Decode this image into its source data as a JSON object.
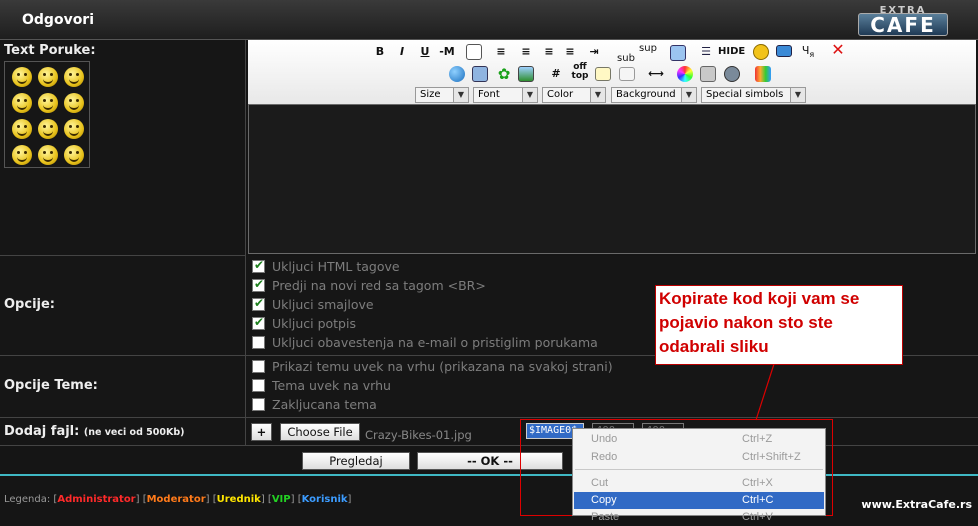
{
  "header": {
    "title": "Odgovori",
    "logo_top": "EXTRA",
    "logo_main": "CAFE"
  },
  "message": {
    "label": "Text Poruke:"
  },
  "toolbar": {
    "hide_label": "HIDE",
    "sub_label": "sub",
    "sup_label": "sup",
    "hash_label": "#",
    "offtop_label": "off top",
    "selects": [
      {
        "label": "Size"
      },
      {
        "label": "Font"
      },
      {
        "label": "Color"
      },
      {
        "label": "Background"
      },
      {
        "label": "Special simbols"
      }
    ]
  },
  "options": {
    "label": "Opcije:",
    "items": [
      {
        "text": "Ukljuci HTML tagove",
        "checked": true
      },
      {
        "text": "Predji na novi red sa tagom <BR>",
        "checked": true
      },
      {
        "text": "Ukljuci smajlove",
        "checked": true
      },
      {
        "text": "Ukljuci potpis",
        "checked": true
      },
      {
        "text": "Ukljuci obavestenja na e-mail o pristiglim porukama",
        "checked": false
      }
    ]
  },
  "topic_options": {
    "label": "Opcije Teme:",
    "items": [
      {
        "text": "Prikazi temu uvek na vrhu (prikazana na svakoj strani)",
        "checked": false
      },
      {
        "text": "Tema uvek na vrhu",
        "checked": false
      },
      {
        "text": "Zakljucana tema",
        "checked": false
      }
    ]
  },
  "file": {
    "label": "Dodaj fajl:",
    "note": "(ne veci od 500Kb)",
    "add_label": "+",
    "choose_label": "Choose File",
    "filename": "Crazy-Bikes-01.jpg",
    "image_code": "$IMAGE0$",
    "width_value": "400",
    "height_value": "400"
  },
  "actions": {
    "preview_label": "Pregledaj",
    "ok_label": "-- OK --"
  },
  "callout": {
    "text": "Kopirate kod koji vam se pojavio nakon sto ste odabrali sliku"
  },
  "context_menu": {
    "items": [
      {
        "label": "Undo",
        "shortcut": "Ctrl+Z"
      },
      {
        "label": "Redo",
        "shortcut": "Ctrl+Shift+Z"
      },
      {
        "label": "Cut",
        "shortcut": "Ctrl+X"
      },
      {
        "label": "Copy",
        "shortcut": "Ctrl+C"
      },
      {
        "label": "Paste",
        "shortcut": "Ctrl+V"
      }
    ]
  },
  "legend": {
    "prefix": "Legenda:",
    "roles": [
      {
        "name": "Administrator",
        "color": "#ff2a2a"
      },
      {
        "name": "Moderator",
        "color": "#ff7a1a"
      },
      {
        "name": "Urednik",
        "color": "#ffe600"
      },
      {
        "name": "VIP",
        "color": "#23d123"
      },
      {
        "name": "Korisnik",
        "color": "#3c9cff"
      }
    ]
  },
  "site_url": "www.ExtraCafe.rs"
}
